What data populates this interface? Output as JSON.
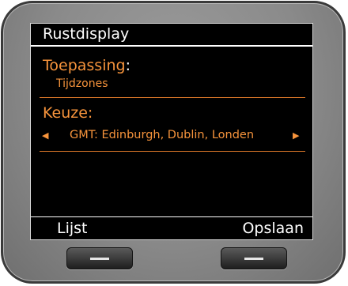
{
  "screen": {
    "title": "Rustdisplay",
    "application": {
      "label": "Toepassing",
      "colon": ":",
      "value": "Tijdzones"
    },
    "choice": {
      "label": "Keuze:",
      "value": "GMT: Edinburgh, Dublin, Londen",
      "left_arrow_icon": "triangle-left-icon",
      "right_arrow_icon": "triangle-right-icon"
    },
    "softkeys": {
      "left": "Lijst",
      "right": "Opslaan"
    }
  },
  "colors": {
    "screen_background": "#000000",
    "accent_orange": "#f7943c",
    "text_white": "#ffffff",
    "device_body": "#8a8a8a"
  },
  "hardware_buttons": [
    {
      "name": "left-softkey-button",
      "icon": "dash-line-icon"
    },
    {
      "name": "right-softkey-button",
      "icon": "dash-line-icon"
    }
  ]
}
